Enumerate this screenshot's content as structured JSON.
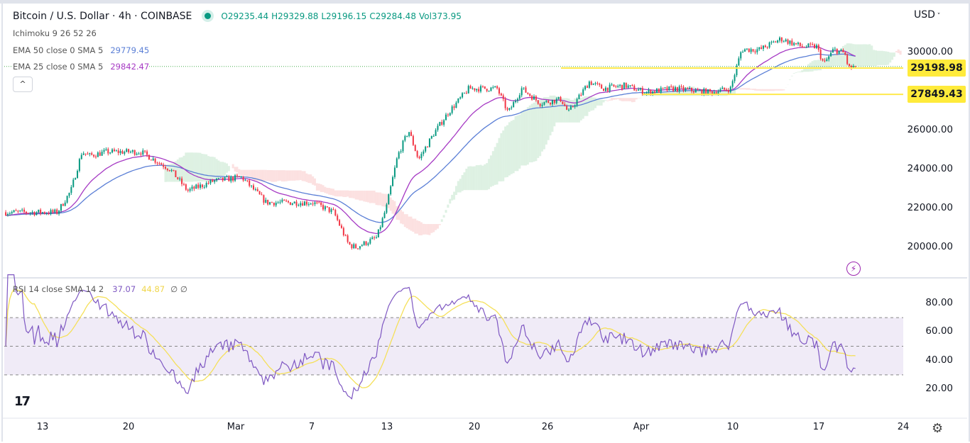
{
  "header": {
    "symbol_title": "Bitcoin / U.S. Dollar · 4h · COINBASE",
    "open": "O29235.44",
    "high": "H29329.88",
    "low": "L29196.15",
    "close": "C29284.48",
    "volume": "Vol373.95",
    "currency": "USD"
  },
  "indicators": {
    "ichimoku": "Ichimoku 9 26 52 26",
    "ema50_label": "EMA 50 close 0 SMA 5",
    "ema50_value": "29779.45",
    "ema25_label": "EMA 25 close 0 SMA 5",
    "ema25_value": "29842.47",
    "rsi_label": "RSI 14 close SMA 14 2",
    "rsi_value": "37.07",
    "rsi_sma_value": "44.87",
    "rsi_extra": "∅ ∅",
    "collapse_icon": "^"
  },
  "colors": {
    "up": "#089981",
    "down": "#f23645",
    "ema50": "#5b7fd6",
    "ema25": "#a63ac4",
    "rsi": "#7e57c2",
    "rsi_sma": "#f5e05a",
    "level": "#ffe94d"
  },
  "chart_data": {
    "type": "candlestick",
    "title": "Bitcoin / U.S. Dollar · 4h · COINBASE",
    "x_unit": "days since Feb 13",
    "price_waypoints": [
      [
        -3,
        21800
      ],
      [
        1.2,
        21800
      ],
      [
        2.3,
        22900
      ],
      [
        3.2,
        24900
      ],
      [
        3.8,
        24700
      ],
      [
        5.2,
        24900
      ],
      [
        8,
        24900
      ],
      [
        10.4,
        24000
      ],
      [
        11.8,
        22900
      ],
      [
        13.9,
        23400
      ],
      [
        16.2,
        23600
      ],
      [
        18.2,
        22300
      ],
      [
        22,
        22300
      ],
      [
        23.7,
        21800
      ],
      [
        24.9,
        20150
      ],
      [
        25.5,
        20000
      ],
      [
        27.2,
        20500
      ],
      [
        28,
        22100
      ],
      [
        28.9,
        24700
      ],
      [
        29.8,
        26000
      ],
      [
        30.6,
        24500
      ],
      [
        31.8,
        25800
      ],
      [
        33,
        26900
      ],
      [
        34.7,
        28150
      ],
      [
        37,
        28150
      ],
      [
        37.9,
        26900
      ],
      [
        39,
        28150
      ],
      [
        40.5,
        27400
      ],
      [
        42.2,
        27600
      ],
      [
        42.8,
        26900
      ],
      [
        44.5,
        28500
      ],
      [
        45.6,
        28150
      ],
      [
        47.4,
        28300
      ],
      [
        49.1,
        27950
      ],
      [
        51.4,
        28150
      ],
      [
        54.3,
        27950
      ],
      [
        56,
        28150
      ],
      [
        56.9,
        30150
      ],
      [
        58.4,
        30150
      ],
      [
        60.1,
        30700
      ],
      [
        61.8,
        30300
      ],
      [
        63,
        30300
      ],
      [
        63.6,
        29400
      ],
      [
        64.4,
        30150
      ],
      [
        65.3,
        29950
      ],
      [
        65.6,
        29200
      ],
      [
        66.2,
        29284.48
      ]
    ],
    "price_axis": [
      "30000.00",
      "24000.00",
      "26000.00",
      "22000.00",
      "20000.00"
    ],
    "price_axis_values": [
      30000,
      24000,
      26000,
      22000,
      20000
    ],
    "levels": [
      {
        "value": 29198.98,
        "label": "29198.98"
      },
      {
        "value": 27849.43,
        "label": "27849.43"
      }
    ],
    "rsi_axis": [
      "80.00",
      "60.00",
      "40.00",
      "20.00"
    ],
    "rsi_axis_values": [
      80,
      60,
      40,
      20
    ],
    "rsi_band": [
      30,
      70
    ],
    "x_ticks": [
      "13",
      "20",
      "Mar",
      "7",
      "13",
      "20",
      "26",
      "Apr",
      "10",
      "17",
      "24"
    ],
    "ylim": [
      19000,
      31200
    ]
  }
}
